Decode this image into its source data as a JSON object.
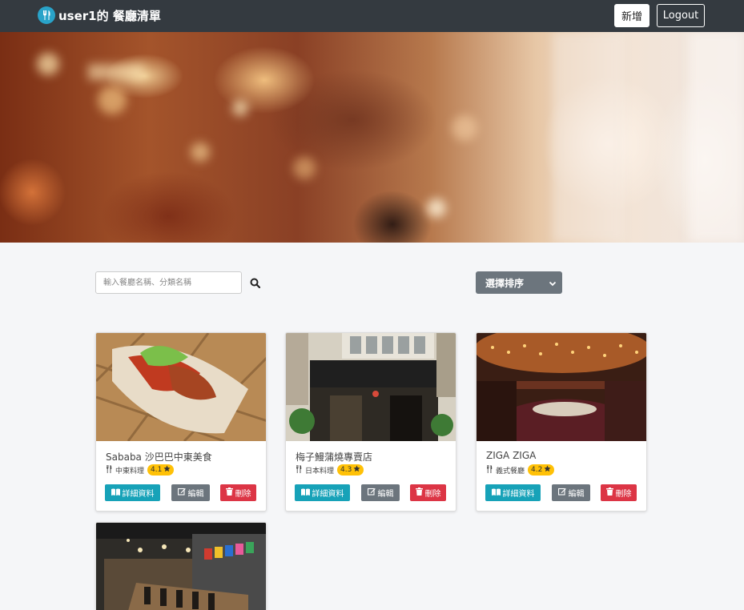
{
  "navbar": {
    "brand": "user1的 餐廳清單",
    "new_button": "新增",
    "logout_button": "Logout",
    "brand_color": "#29a3c9"
  },
  "search": {
    "placeholder": "輸入餐廳名稱、分類名稱",
    "value": ""
  },
  "sort": {
    "selected": "選擇排序"
  },
  "restaurants": [
    {
      "name": "Sababa 沙巴巴中東美食",
      "category": "中東料理",
      "rating": "4.1"
    },
    {
      "name": "梅子鰻蒲燒專賣店",
      "category": "日本料理",
      "rating": "4.3"
    },
    {
      "name": "ZIGA ZIGA",
      "category": "義式餐廳",
      "rating": "4.2"
    },
    {
      "name": "",
      "category": "",
      "rating": ""
    }
  ],
  "card_buttons": {
    "detail": "詳細資料",
    "edit": "編輯",
    "delete": "刪除"
  },
  "colors": {
    "navbar": "#343a40",
    "detail": "#17a2b8",
    "edit": "#6c757d",
    "delete": "#dc3545",
    "rating": "#ffc107"
  },
  "icons": [
    "utensils-icon",
    "search-icon",
    "chevron-down-icon",
    "book-icon",
    "edit-icon",
    "trash-icon",
    "star-icon"
  ]
}
